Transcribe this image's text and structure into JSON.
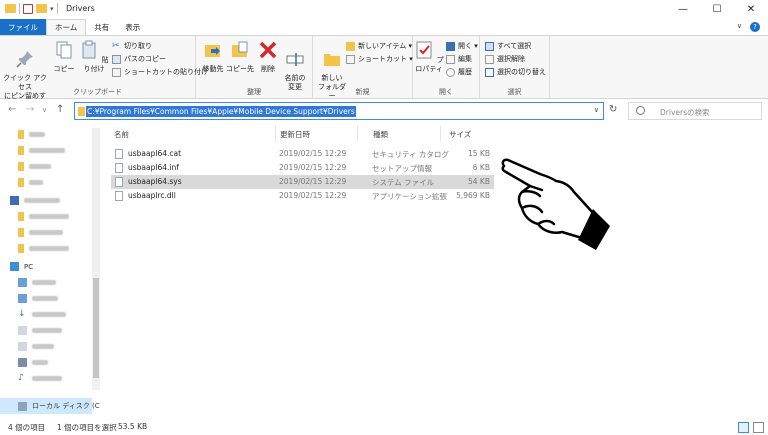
{
  "window": {
    "title": "Drivers",
    "controls": {
      "minimize": "—",
      "maximize": "☐",
      "close": "✕"
    }
  },
  "ribbon_tabs": {
    "file": "ファイル",
    "home": "ホーム",
    "share": "共有",
    "view": "表示"
  },
  "ribbon": {
    "clipboard": {
      "pin_label": "クイック アクセス\nにピン留めする",
      "copy_label": "コピー",
      "paste_label": "貼り付け",
      "cut_label": "切り取り",
      "copy_path_label": "パスのコピー",
      "paste_shortcut_label": "ショートカットの貼り付け",
      "group_label": "クリップボード"
    },
    "organize": {
      "move_to_label": "移動先",
      "copy_to_label": "コピー先",
      "delete_label": "削除",
      "rename_label": "名前の\n変更",
      "group_label": "整理"
    },
    "new": {
      "new_folder_label": "新しい\nフォルダー",
      "new_item_label": "新しいアイテム ▾",
      "shortcut_label": "ショートカット ▾",
      "group_label": "新規"
    },
    "open": {
      "properties_label": "プロパティ",
      "open_label": "開く ▾",
      "edit_label": "編集",
      "history_label": "履歴",
      "group_label": "開く"
    },
    "select": {
      "select_all_label": "すべて選択",
      "select_none_label": "選択解除",
      "invert_label": "選択の切り替え",
      "group_label": "選択"
    }
  },
  "address": {
    "path": "C:¥Program Files¥Common Files¥Apple¥Mobile Device Support¥Drivers",
    "search_placeholder": "Driversの検索"
  },
  "nav": {
    "pc_label": "PC",
    "local_disk_label": "ローカル ディスク (C"
  },
  "columns": {
    "name": "名前",
    "date": "更新日時",
    "type": "種類",
    "size": "サイズ"
  },
  "files": [
    {
      "name": "usbaapl64.cat",
      "date": "2019/02/15 12:29",
      "type": "セキュリティ カタログ",
      "size": "15 KB"
    },
    {
      "name": "usbaapl64.inf",
      "date": "2019/02/15 12:29",
      "type": "セットアップ情報",
      "size": "6 KB"
    },
    {
      "name": "usbaapl64.sys",
      "date": "2019/02/15 12:29",
      "type": "システム ファイル",
      "size": "54 KB"
    },
    {
      "name": "usbaaplrc.dll",
      "date": "2019/02/15 12:29",
      "type": "アプリケーション拡張",
      "size": "5,969 KB"
    }
  ],
  "status": {
    "item_count": "4 個の項目",
    "selected": "1 個の項目を選択",
    "selected_size": "53.5 KB"
  }
}
